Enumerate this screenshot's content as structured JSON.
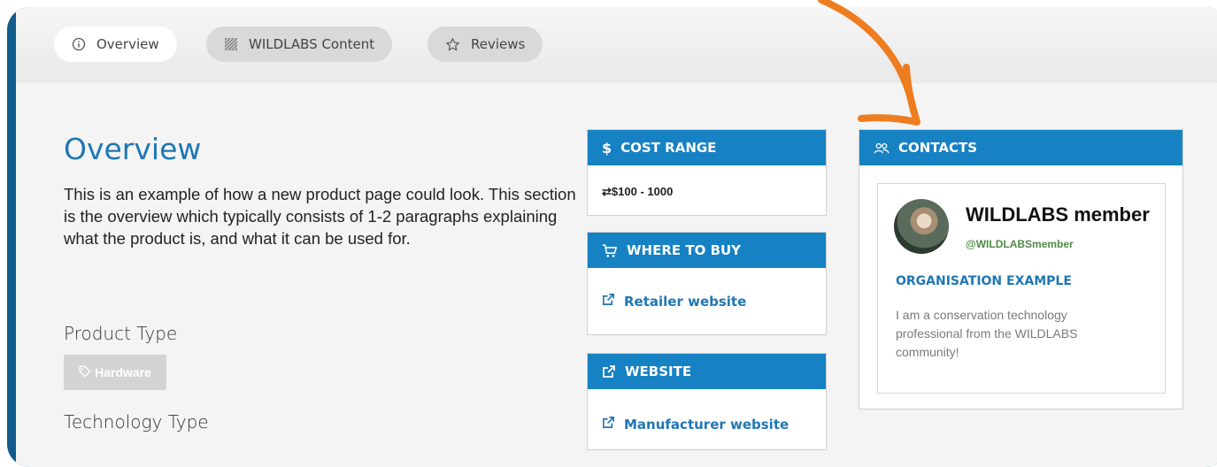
{
  "tabs": [
    {
      "label": "Overview",
      "icon": "info-circle-icon",
      "active": true
    },
    {
      "label": "WILDLABS Content",
      "icon": "hatched-square-icon",
      "active": false
    },
    {
      "label": "Reviews",
      "icon": "star-outline-icon",
      "active": false
    }
  ],
  "overview": {
    "heading": "Overview",
    "description": "This is an example of how a new product page could look. This section is the overview which typically consists of 1-2 paragraphs explaining what the product is, and what it can be used for.",
    "product_type_label": "Product Type",
    "product_type_tag": "Hardware",
    "technology_type_label": "Technology Type"
  },
  "cost": {
    "title": "COST RANGE",
    "icon": "dollar-icon",
    "value_icon": "exchange-icon",
    "value": "$100 - 1000"
  },
  "where_to_buy": {
    "title": "WHERE TO BUY",
    "icon": "cart-icon",
    "link_icon": "external-link-icon",
    "link": "Retailer website"
  },
  "website": {
    "title": "WEBSITE",
    "icon": "external-link-icon",
    "link_icon": "external-link-icon",
    "link": "Manufacturer website"
  },
  "contacts": {
    "title": "CONTACTS",
    "icon": "users-icon",
    "name": "WILDLABS member",
    "handle": "@WILDLABSmember",
    "organisation": "ORGANISATION EXAMPLE",
    "bio": "I am a conservation technology professional from the WILDLABS community!"
  },
  "colors": {
    "accent_blue": "#1681c3",
    "link_blue": "#1f77b4",
    "frame_blue": "#115b8d",
    "handle_green": "#4f8b47",
    "annotation_orange": "#ee7d1f"
  }
}
